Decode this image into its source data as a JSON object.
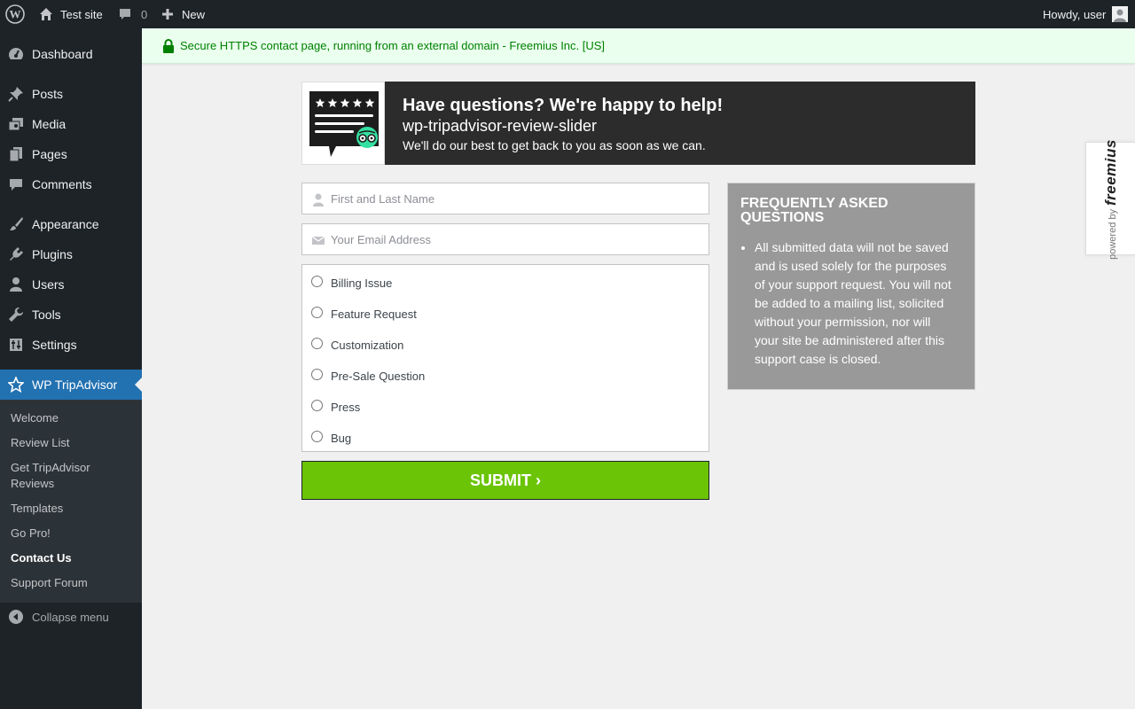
{
  "adminbar": {
    "site_name": "Test site",
    "comments_count": "0",
    "new_label": "New",
    "howdy": "Howdy, user"
  },
  "sidebar": {
    "items": [
      {
        "label": "Dashboard",
        "icon": "dashboard-icon"
      },
      {
        "label": "Posts",
        "icon": "pin-icon"
      },
      {
        "label": "Media",
        "icon": "media-icon"
      },
      {
        "label": "Pages",
        "icon": "pages-icon"
      },
      {
        "label": "Comments",
        "icon": "comments-icon"
      },
      {
        "label": "Appearance",
        "icon": "brush-icon"
      },
      {
        "label": "Plugins",
        "icon": "plugin-icon"
      },
      {
        "label": "Users",
        "icon": "users-icon"
      },
      {
        "label": "Tools",
        "icon": "wrench-icon"
      },
      {
        "label": "Settings",
        "icon": "settings-icon"
      },
      {
        "label": "WP TripAdvisor",
        "icon": "star-icon"
      }
    ],
    "submenu": [
      {
        "label": "Welcome"
      },
      {
        "label": "Review List"
      },
      {
        "label": "Get TripAdvisor Reviews"
      },
      {
        "label": "Templates"
      },
      {
        "label": "Go Pro!"
      },
      {
        "label": "Contact Us"
      },
      {
        "label": "Support Forum"
      }
    ],
    "collapse_label": "Collapse menu"
  },
  "secure_notice": "Secure HTTPS contact page, running from an external domain - Freemius Inc. [US]",
  "header": {
    "title": "Have questions? We're happy to help!",
    "plugin": "wp-tripadvisor-review-slider",
    "description": "We'll do our best to get back to you as soon as we can."
  },
  "form": {
    "name_placeholder": "First and Last Name",
    "email_placeholder": "Your Email Address",
    "options": [
      "Billing Issue",
      "Feature Request",
      "Customization",
      "Pre-Sale Question",
      "Press",
      "Bug"
    ],
    "submit_label": "SUBMIT ›"
  },
  "faq": {
    "title": "FREQUENTLY ASKED QUESTIONS",
    "items": [
      "All submitted data will not be saved and is used solely for the purposes of your support request. You will not be added to a mailing list, solicited without your permission, nor will your site be administered after this support case is closed."
    ]
  },
  "freemius": {
    "powered_by": "powered by",
    "brand": "freemius"
  },
  "colors": {
    "admin_dark": "#1d2327",
    "accent_blue": "#2271b1",
    "submit_green": "#6bc406",
    "secure_green": "#008000"
  }
}
